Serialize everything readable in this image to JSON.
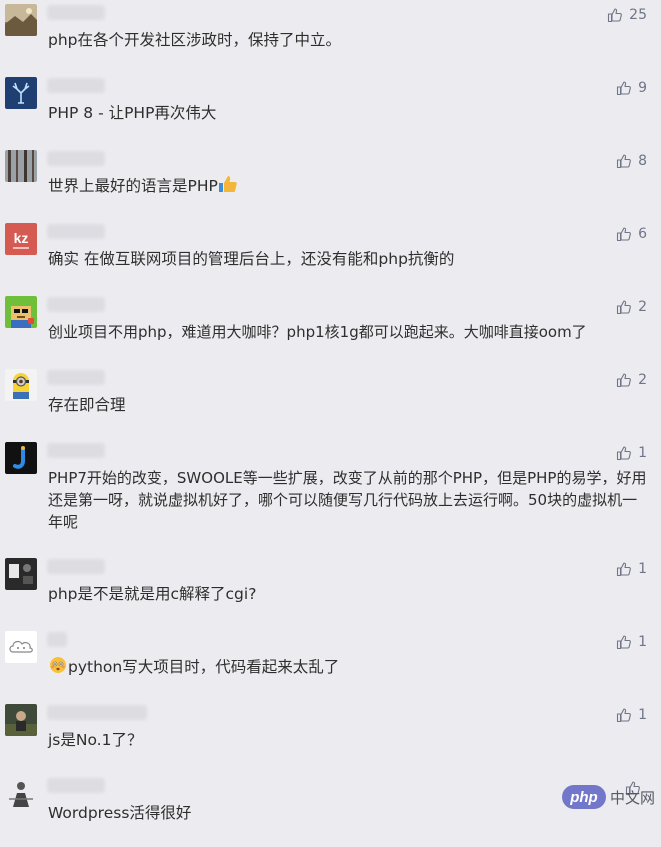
{
  "colors": {
    "background": "#ececf0",
    "text": "#2e2e2e",
    "like_icon": "#6e7587",
    "watermark_badge": "#7377c9"
  },
  "comments": [
    {
      "avatar_icon": "landscape-photo-avatar-icon",
      "text": "php在各个开发社区涉政时，保持了中立。",
      "likes": "25"
    },
    {
      "avatar_icon": "deer-logo-avatar-icon",
      "text": "PHP 8 - 让PHP再次伟大",
      "likes": "9"
    },
    {
      "avatar_icon": "forest-photo-avatar-icon",
      "text": "世界上最好的语言是PHP",
      "likes": "8"
    },
    {
      "avatar_icon": "kz-logo-avatar-icon",
      "text": "确实 在做互联网项目的管理后台上，还没有能和php抗衡的",
      "likes": "6"
    },
    {
      "avatar_icon": "pixel-character-avatar-icon",
      "text": "创业项目不用php，难道用大咖啡？php1核1g都可以跑起来。大咖啡直接oom了",
      "likes": "2"
    },
    {
      "avatar_icon": "minion-avatar-icon",
      "text": "存在即合理",
      "likes": "2"
    },
    {
      "avatar_icon": "blue-j-logo-avatar-icon",
      "text": "PHP7开始的改变，SWOOLE等一些扩展，改变了从前的那个PHP，但是PHP的易学，好用还是第一呀，就说虚拟机好了，哪个可以随便写几行代码放上去运行啊。50块的虚拟机一年呢",
      "likes": "1"
    },
    {
      "avatar_icon": "dark-photo-avatar-icon",
      "text": "php是不是就是用c解释了cgi?",
      "likes": "1"
    },
    {
      "avatar_icon": "cloud-avatar-icon",
      "text": "python写大项目时，代码看起来太乱了",
      "likes": "1"
    },
    {
      "avatar_icon": "outdoor-photo-avatar-icon",
      "text": "js是No.1了？",
      "likes": "1"
    },
    {
      "avatar_icon": "figure-avatar-icon",
      "text": "Wordpress活得很好",
      "likes": ""
    }
  ],
  "watermark": {
    "badge": "php",
    "label": "中文网"
  }
}
